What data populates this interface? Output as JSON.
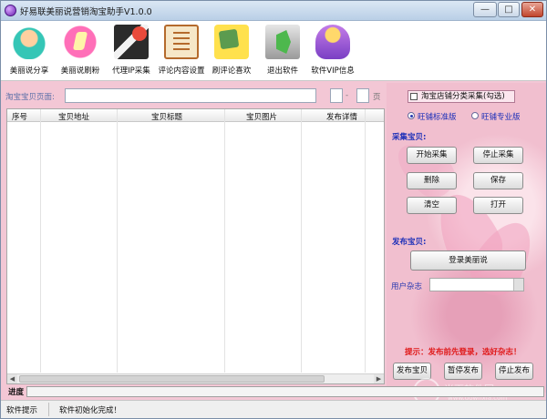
{
  "window": {
    "title": "好易联美丽说营销淘宝助手V1.0.0",
    "controls": {
      "minimize": "—",
      "maximize": "□",
      "close": "✕"
    }
  },
  "toolbar": {
    "items": [
      {
        "label": "美丽说分享",
        "icon": "share-girl-icon"
      },
      {
        "label": "美丽说刷粉",
        "icon": "fans-icon"
      },
      {
        "label": "代理IP采集",
        "icon": "clapperboard-icon"
      },
      {
        "label": "评论内容设置",
        "icon": "notebook-icon"
      },
      {
        "label": "刷评论喜欢",
        "icon": "comment-like-icon"
      },
      {
        "label": "退出软件",
        "icon": "exit-arrow-icon"
      },
      {
        "label": "软件VIP信息",
        "icon": "vip-flower-icon"
      }
    ]
  },
  "collect": {
    "url_label": "淘宝宝贝页面:",
    "url_value": "",
    "page_sep": "-",
    "page_unit": "页",
    "category_checkbox": "淘宝店铺分类采集(勾选)",
    "radio_standard": "旺铺标准版",
    "radio_pro": "旺铺专业版",
    "selected_radio": "standard"
  },
  "table": {
    "columns": [
      "序号",
      "宝贝地址",
      "宝贝标题",
      "宝贝图片",
      "发布详情"
    ],
    "rows": []
  },
  "actions": {
    "collect_title": "采集宝贝:",
    "start_collect": "开始采集",
    "stop_collect": "停止采集",
    "delete": "删除",
    "save": "保存",
    "clear": "清空",
    "open": "打开",
    "publish_title": "发布宝贝:",
    "login": "登录美丽说",
    "user_label": "用户杂志",
    "tip": "提示：发布前先登录，选好杂志！",
    "publish": "发布宝贝",
    "pause_publish": "暂停发布",
    "stop_publish": "停止发布"
  },
  "progress": {
    "label": "进度",
    "value": 0
  },
  "status": {
    "label": "软件提示",
    "message": "软件初始化完成！"
  },
  "watermark": {
    "text": "当下软件园",
    "sub": "www.downxia.com"
  }
}
